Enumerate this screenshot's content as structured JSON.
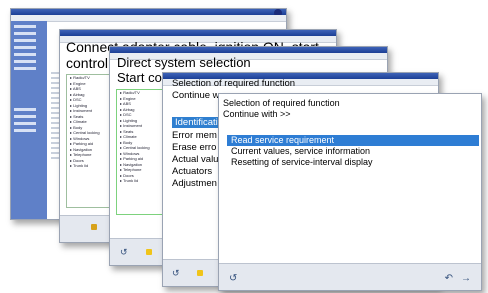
{
  "window1": {
    "title_icon": "app-icon",
    "accent": "#5f80c8"
  },
  "window2": {
    "heading_line1": "Connect adapter cable, ignition ON, start",
    "heading_line2": "control u",
    "tree_items": [
      "Radio/TV",
      "Engine",
      "ABS",
      "Airbag",
      "DSC",
      "Lighting",
      "Instrument",
      "Seats",
      "Climate",
      "Body",
      "Central locking",
      "Windows",
      "Parking aid",
      "Navigation",
      "Telephone",
      "Doors",
      "Trunk lid"
    ]
  },
  "window3": {
    "heading_line1": "Direct system selection",
    "heading_line2": "Start con",
    "tree_items": [
      "Radio/TV",
      "Engine",
      "ABS",
      "Airbag",
      "DSC",
      "Lighting",
      "Instrument",
      "Seats",
      "Climate",
      "Body",
      "Central locking",
      "Windows",
      "Parking aid",
      "Navigation",
      "Telephone",
      "Doors",
      "Trunk lid"
    ]
  },
  "window4": {
    "heading_line1": "Selection of required function",
    "heading_line2": "Continue w",
    "items": [
      "Identificati",
      "Error mem",
      "Erase erro",
      "Actual valu",
      "Actuators",
      "Adjustmen"
    ]
  },
  "window5": {
    "heading_line1": "Selection of required function",
    "heading_line2": "Continue with >>",
    "items": [
      "Read service requirement",
      "Current values, service information",
      "Resetting of service-interval display"
    ],
    "selected_index": 0,
    "selection_color": "#2e7dd4"
  }
}
